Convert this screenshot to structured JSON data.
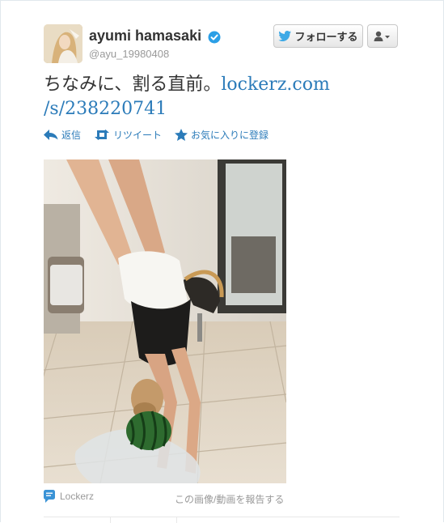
{
  "tweet": {
    "display_name": "ayumi hamasaki",
    "handle": "@ayu_19980408",
    "text": "ちなみに、割る直前。",
    "link_line1": "lockerz.com",
    "link_line2": "/s/238220741"
  },
  "buttons": {
    "follow_label": "フォローする"
  },
  "actions": {
    "reply": "返信",
    "retweet": "リツイート",
    "favorite": "お気に入りに登録"
  },
  "media": {
    "source": "Lockerz",
    "report": "この画像/動画を報告する"
  },
  "icons": {
    "verified": "verified-badge-icon",
    "bird": "twitter-bird-icon",
    "user_menu": "user-icon",
    "reply": "reply-arrow-icon",
    "retweet": "retweet-icon",
    "favorite": "star-icon",
    "source": "speech-bubble-icon"
  },
  "colors": {
    "link": "#2b7bb9",
    "verified": "#2b9fe6",
    "muted": "#999999"
  }
}
